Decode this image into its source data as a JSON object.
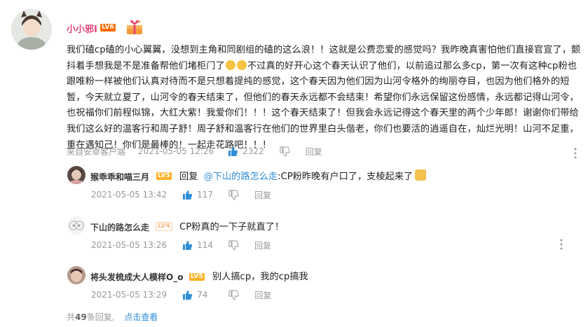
{
  "main_comment": {
    "username": "小小邪I",
    "level_badge": "LV6",
    "text_parts": [
      "我们磕cp磕的小心翼翼，没想到主角和同剧组的磕的这么浪！！这就是公费恋爱的感觉吗？我昨晚真害怕他们直接官宣了，颤抖着手想我是不是准备帮他们堵柜门了",
      "不过真的好开心这个春天认识了他们，以前追过那么多cp，第一次有这种cp粉也跟唯粉一样被他们认真对待而不是只想着提纯的感觉，这个春天因为他们因为山河令格外的绚丽夺目，也因为他们格外的短暂，今天就立夏了，山河令的春天结束了，但他们的春天永远都不会结束！希望你们永远保留这份感情，永远都记得山河令，也祝福你们前程似锦，大红大紫！我爱你们！！！这个春天结束了！但我会永远记得这个春天里的两个少年郎！谢谢你们带给我们这么好的温客行和周子舒！周子舒和温客行在他们的世界里白头偕老，你们也要活的逍遥自在，灿烂光明！山河不足重，重在遇知己！你们是最棒的！一起走花路吧！！！"
    ],
    "source": "来自安卓客户端",
    "timestamp": "2021-05-05 12:26",
    "likes": "2322",
    "reply_label": "回复"
  },
  "replies": [
    {
      "username": "猴乖乖和喵三月",
      "user_color": "#e0457b",
      "level_badge": "LV5",
      "reply_prefix": "回复",
      "mention": "@下山的路怎么走",
      "text": ":CP粉昨晚有户口了，支棱起来了",
      "timestamp": "2021-05-05 13:42",
      "likes": "117",
      "reply_label": "回复"
    },
    {
      "username": "下山的路怎么走",
      "user_color": "#444444",
      "level_badge": "LV4",
      "text": "CP粉真的一下子就直了！",
      "timestamp": "2021-05-05 13:26",
      "likes": "114",
      "reply_label": "回复"
    },
    {
      "username": "将头发梳成大人模样O_o",
      "user_color": "#e0457b",
      "level_badge": "LV5",
      "text": "别人搞cp，我的cp搞我",
      "timestamp": "2021-05-05 13:29",
      "likes": "74",
      "reply_label": "回复"
    }
  ],
  "footer": {
    "prefix": "共",
    "count": "49",
    "suffix": "条回复,",
    "view_link": "点击查看"
  },
  "colors": {
    "accent_pink": "#e0457b",
    "link_blue": "#2e8ed8",
    "like_blue": "#2e8ed8",
    "level_orange": "#ff6c00"
  },
  "icons": [
    "like-icon",
    "dislike-icon",
    "more-icon",
    "gift-icon",
    "emoji-icon"
  ]
}
